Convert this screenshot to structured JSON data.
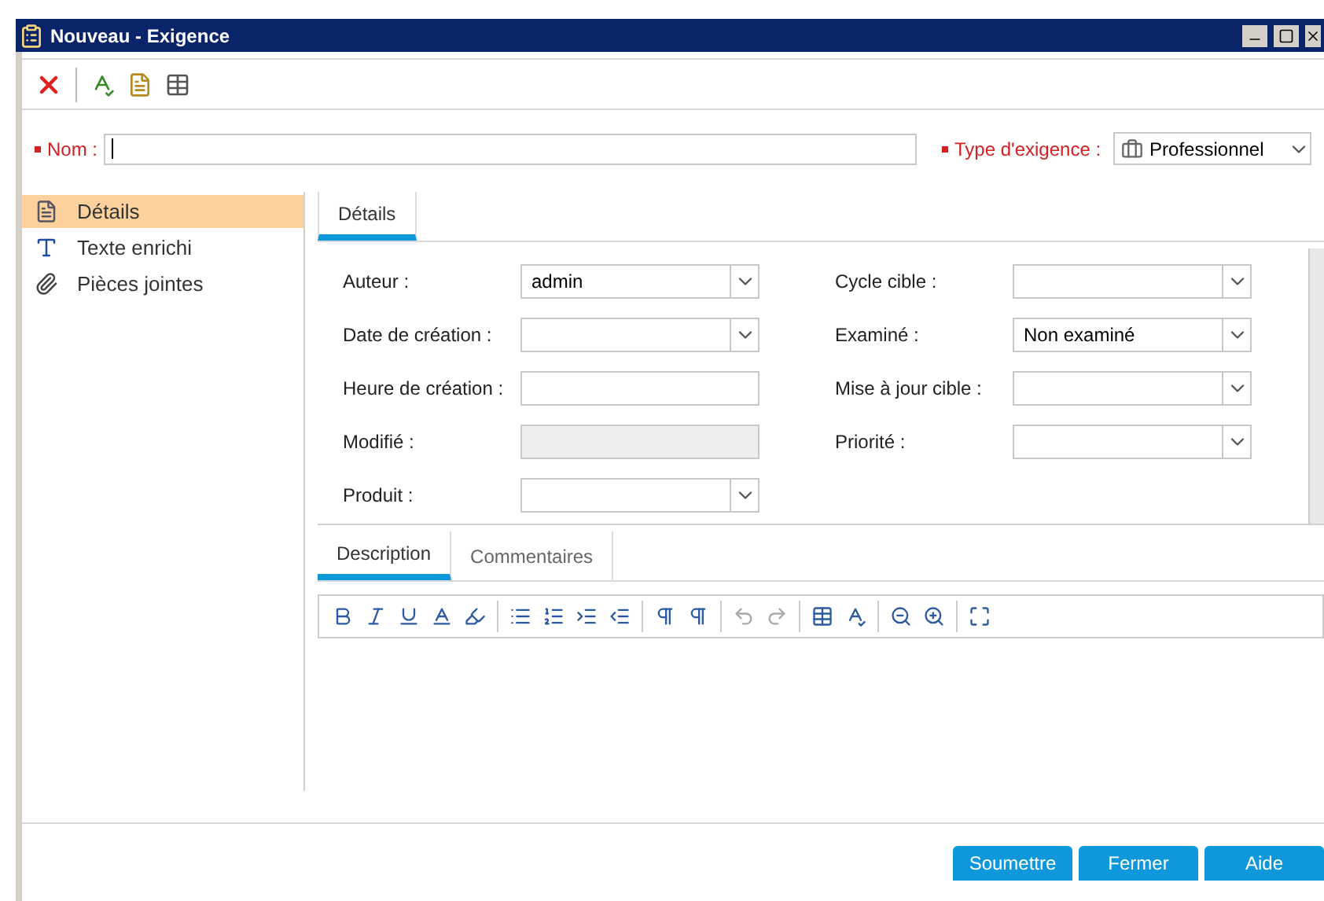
{
  "window": {
    "title": "Nouveau - Exigence"
  },
  "name_field": {
    "label": "Nom :",
    "required": true
  },
  "type_field": {
    "label": "Type d'exigence :",
    "required": true,
    "value": "Professionnel"
  },
  "sidebar": {
    "items": [
      {
        "label": "Détails",
        "selected": true,
        "kind": "details"
      },
      {
        "label": "Texte enrichi",
        "selected": false,
        "kind": "richtext"
      },
      {
        "label": "Pièces jointes",
        "selected": false,
        "kind": "attachment"
      }
    ]
  },
  "top_tabs": [
    {
      "label": "Détails",
      "selected": true
    }
  ],
  "form": {
    "left": [
      {
        "label": "Auteur :",
        "kind": "dropdown",
        "value": "admin"
      },
      {
        "label": "Date de création :",
        "kind": "dropdown"
      },
      {
        "label": "Heure de création :",
        "kind": "text"
      },
      {
        "label": "Modifié :",
        "kind": "readonly"
      },
      {
        "label": "Produit :",
        "kind": "dropdown"
      }
    ],
    "right": [
      {
        "label": "Cycle cible :",
        "kind": "dropdown"
      },
      {
        "label": "Examiné :",
        "kind": "dropdown",
        "value": "Non examiné"
      },
      {
        "label": "Mise à jour cible :",
        "kind": "dropdown"
      },
      {
        "label": "Priorité :",
        "kind": "dropdown"
      }
    ]
  },
  "bottom_tabs": [
    {
      "label": "Description",
      "selected": true
    },
    {
      "label": "Commentaires",
      "selected": false
    }
  ],
  "buttons": [
    "Soumettre",
    "Fermer",
    "Aide"
  ]
}
